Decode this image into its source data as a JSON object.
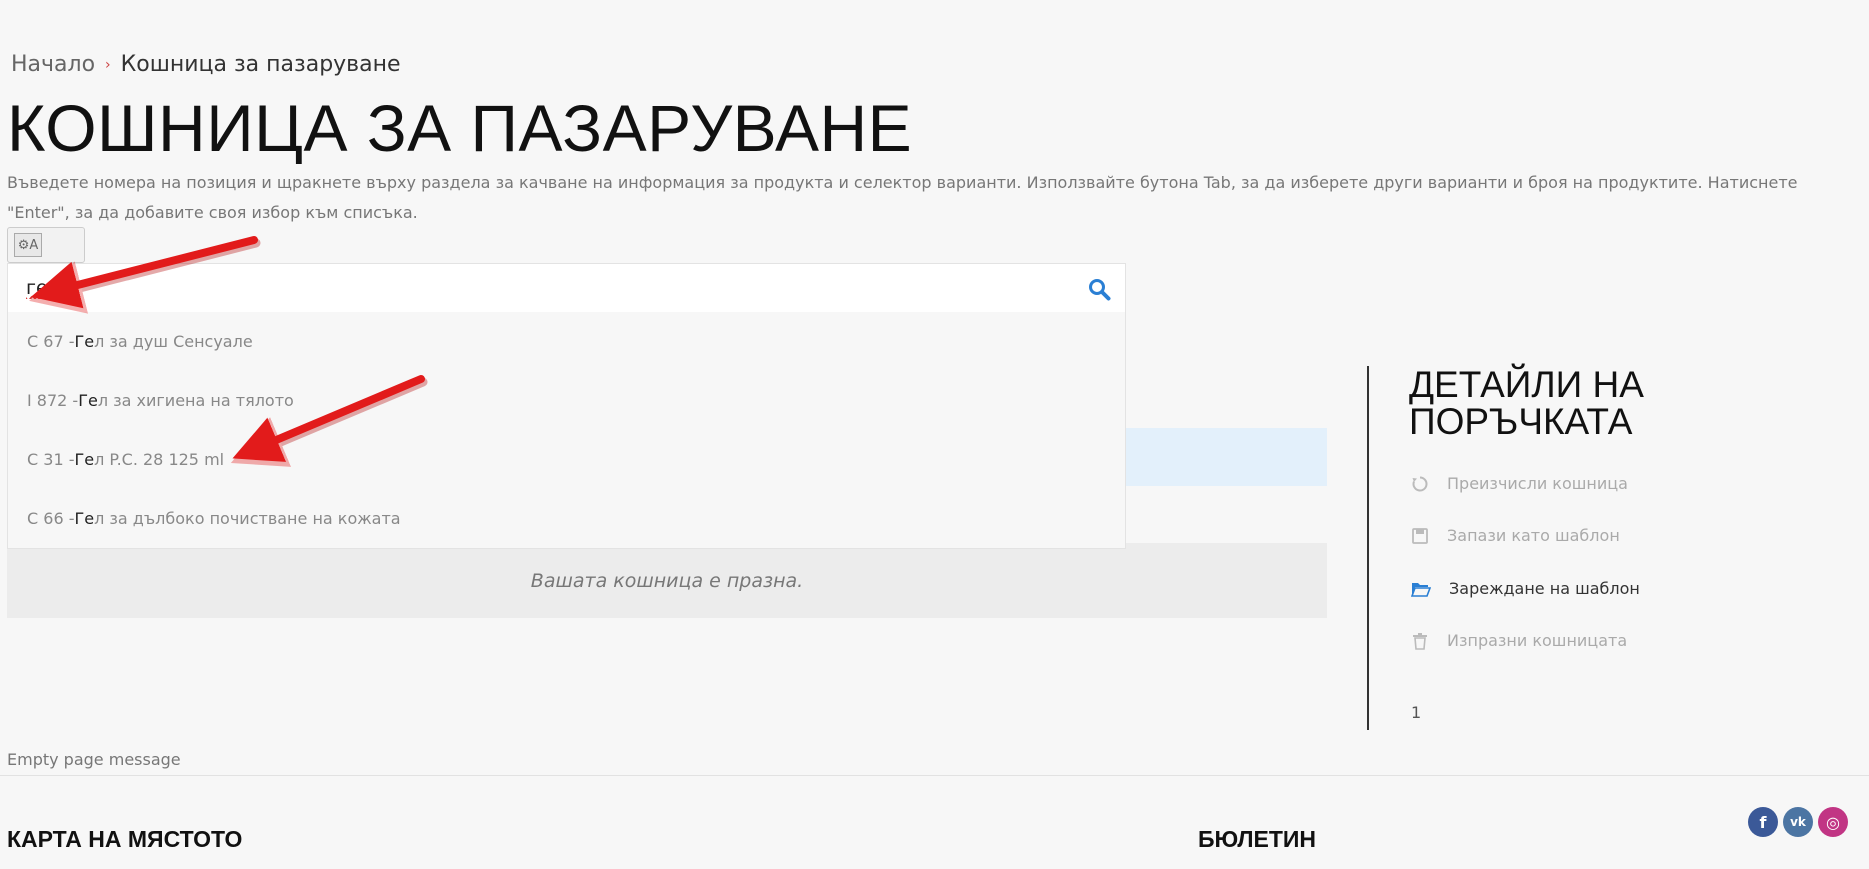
{
  "breadcrumb": {
    "home": "Начало",
    "separator": "›",
    "current": "Кошница за пазаруване"
  },
  "page_title": "КОШНИЦА ЗА ПАЗАРУВАНЕ",
  "instructions": "Въведете номера на позиция и щракнете върху раздела за качване на информация за продукта и селектор варианти. Използвайте бутона Tab, за да изберете други варианти и броя на продуктите. Натиснете \"Enter\", за да добавите своя избор към списъка.",
  "mode_toggle": {
    "icon_label": "⚙A"
  },
  "search": {
    "value": "ге",
    "icon": "search-icon"
  },
  "suggestions": [
    {
      "code": "С 67 - ",
      "match": "Ге",
      "rest": "л за душ Сенсуале"
    },
    {
      "code": "I 872 - ",
      "match": "Ге",
      "rest": "л за хигиена на тялото"
    },
    {
      "code": "С 31 - ",
      "match": "Ге",
      "rest": "л P.C. 28 125 ml"
    },
    {
      "code": "С 66 - ",
      "match": "Ге",
      "rest": "л за дълбоко почистване на кожата"
    }
  ],
  "cart": {
    "empty_text": "Вашата кошница е празна."
  },
  "order_details": {
    "title": "ДЕТАЙЛИ НА ПОРЪЧКАТА",
    "actions": [
      {
        "label": "Преизчисли кошница",
        "icon": "refresh-icon",
        "active": false
      },
      {
        "label": "Запази като шаблон",
        "icon": "save-icon",
        "active": false
      },
      {
        "label": "Зареждане на шаблон",
        "icon": "folder-open-icon",
        "active": true
      },
      {
        "label": "Изпразни кошницата",
        "icon": "trash-icon",
        "active": false
      }
    ],
    "count": "1"
  },
  "empty_page_message": "Empty page message",
  "footer": {
    "sitemap": "КАРТА НА МЯСТОТО",
    "newsletter": "БЮЛЕТИН"
  },
  "social": [
    {
      "name": "facebook-icon",
      "glyph": "f",
      "color": "#3b5998"
    },
    {
      "name": "vk-icon",
      "glyph": "vk",
      "color": "#4c75a3"
    },
    {
      "name": "instagram-icon",
      "glyph": "◎",
      "color": "#c13584"
    }
  ],
  "colors": {
    "accent": "#2a7fd4",
    "arrow": "#e21b1b",
    "highlight_row": "#e3f0fb"
  }
}
